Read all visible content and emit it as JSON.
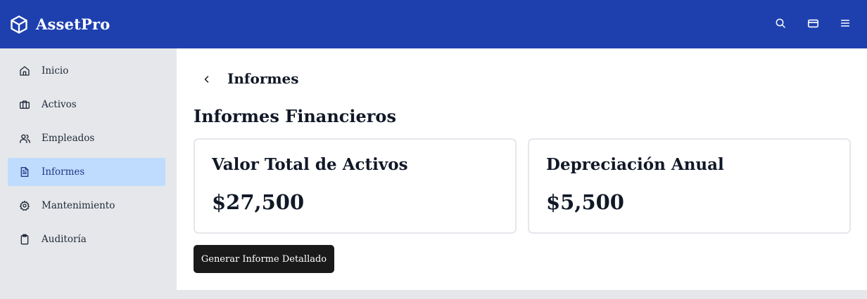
{
  "header": {
    "brand": "AssetPro",
    "brand_icon": "cube-icon",
    "actions": [
      {
        "name": "search-icon"
      },
      {
        "name": "credit-card-icon"
      },
      {
        "name": "menu-icon"
      }
    ],
    "color": "#1e40af"
  },
  "sidebar": {
    "items": [
      {
        "label": "Inicio",
        "icon": "home-icon"
      },
      {
        "label": "Activos",
        "icon": "briefcase-icon"
      },
      {
        "label": "Empleados",
        "icon": "users-icon"
      },
      {
        "label": "Informes",
        "icon": "file-text-icon",
        "active": true
      },
      {
        "label": "Mantenimiento",
        "icon": "gear-icon"
      },
      {
        "label": "Auditoría",
        "icon": "clipboard-icon"
      }
    ],
    "active_color": "#bfdbfe"
  },
  "main": {
    "title": "Informes",
    "section_title": "Informes Financieros",
    "cards": [
      {
        "label": "Valor Total de Activos",
        "value": "$27,500"
      },
      {
        "label": "Depreciación Anual",
        "value": "$5,500"
      }
    ],
    "button_label": "Generar Informe Detallado"
  }
}
